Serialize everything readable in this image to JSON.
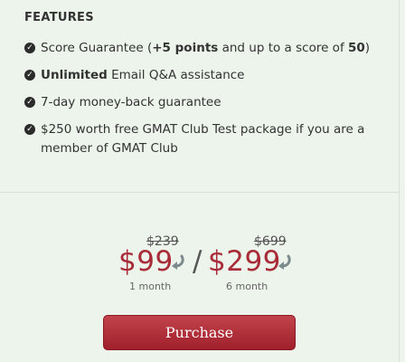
{
  "features": {
    "title": "FEATURES",
    "items": [
      {
        "pre": "Score Guarantee (",
        "bold": "+5 points",
        "post": " and up to a score of ",
        "bold2": "50",
        "post2": ")"
      },
      {
        "pre": "",
        "bold": "Unlimited",
        "post": " Email Q&A assistance",
        "bold2": "",
        "post2": ""
      },
      {
        "pre": "7-day money-back guarantee",
        "bold": "",
        "post": "",
        "bold2": "",
        "post2": ""
      },
      {
        "pre": "$250 worth free GMAT Club Test package if you are a member of GMAT Club",
        "bold": "",
        "post": "",
        "bold2": "",
        "post2": ""
      }
    ]
  },
  "pricing": {
    "plan1": {
      "old": "$239",
      "price": "$99",
      "period": "1 month"
    },
    "separator": "/",
    "plan2": {
      "old": "$699",
      "price": "$299",
      "period": "6 month"
    }
  },
  "purchase_label": "Purchase",
  "icons": {
    "check": "check-circle-icon",
    "arrow": "curved-arrow-icon"
  },
  "colors": {
    "price": "#a72c37",
    "button": "#b0313b",
    "background": "#edf4ec"
  }
}
